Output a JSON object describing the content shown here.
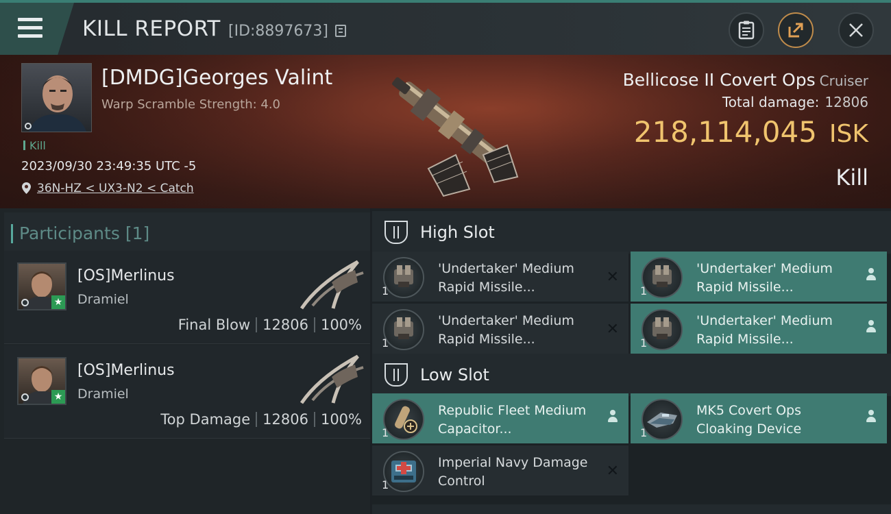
{
  "header": {
    "title": "KILL REPORT",
    "report_id": "[ID:8897673]"
  },
  "victim": {
    "name": "[DMDG]Georges Valint",
    "subtitle": "Warp Scramble Strength: 4.0",
    "tag": "Kill",
    "datetime": "2023/09/30 23:49:35 UTC -5",
    "location": "36N-HZ < UX3-N2 < Catch",
    "ship_name": "Bellicose II Covert Ops",
    "ship_class": "Cruiser",
    "total_damage_label": "Total damage:",
    "total_damage": "12806",
    "isk_value": "218,114,045",
    "isk_unit": "ISK",
    "result": "Kill"
  },
  "participants": {
    "title": "Participants",
    "count": "[1]",
    "rows": [
      {
        "name": "[OS]Merlinus",
        "ship": "Dramiel",
        "role": "Final Blow",
        "damage": "12806",
        "percent": "100%"
      },
      {
        "name": "[OS]Merlinus",
        "ship": "Dramiel",
        "role": "Top Damage",
        "damage": "12806",
        "percent": "100%"
      }
    ]
  },
  "slots": {
    "high": {
      "title": "High Slot",
      "modules": [
        {
          "name": "'Undertaker' Medium Rapid Missile...",
          "qty": "1",
          "state": "destroyed"
        },
        {
          "name": "'Undertaker' Medium Rapid Missile...",
          "qty": "1",
          "state": "dropped"
        },
        {
          "name": "'Undertaker' Medium Rapid Missile...",
          "qty": "1",
          "state": "destroyed"
        },
        {
          "name": "'Undertaker' Medium Rapid Missile...",
          "qty": "1",
          "state": "dropped"
        }
      ]
    },
    "low": {
      "title": "Low Slot",
      "modules": [
        {
          "name": "Republic Fleet Medium Capacitor...",
          "qty": "1",
          "state": "dropped"
        },
        {
          "name": "MK5 Covert Ops Cloaking Device",
          "qty": "1",
          "state": "dropped"
        },
        {
          "name": "Imperial Navy Damage Control",
          "qty": "1",
          "state": "destroyed"
        }
      ]
    }
  },
  "icons": {
    "menu": "menu-icon",
    "clipboard": "clipboard-icon",
    "share": "share-icon",
    "close": "close-icon",
    "pin": "location-pin-icon",
    "destroyed": "x-icon",
    "dropped": "person-icon"
  },
  "colors": {
    "accent_teal": "#3f7b72",
    "isk_gold": "#f0c46e",
    "kill_green": "#5fa88f"
  }
}
